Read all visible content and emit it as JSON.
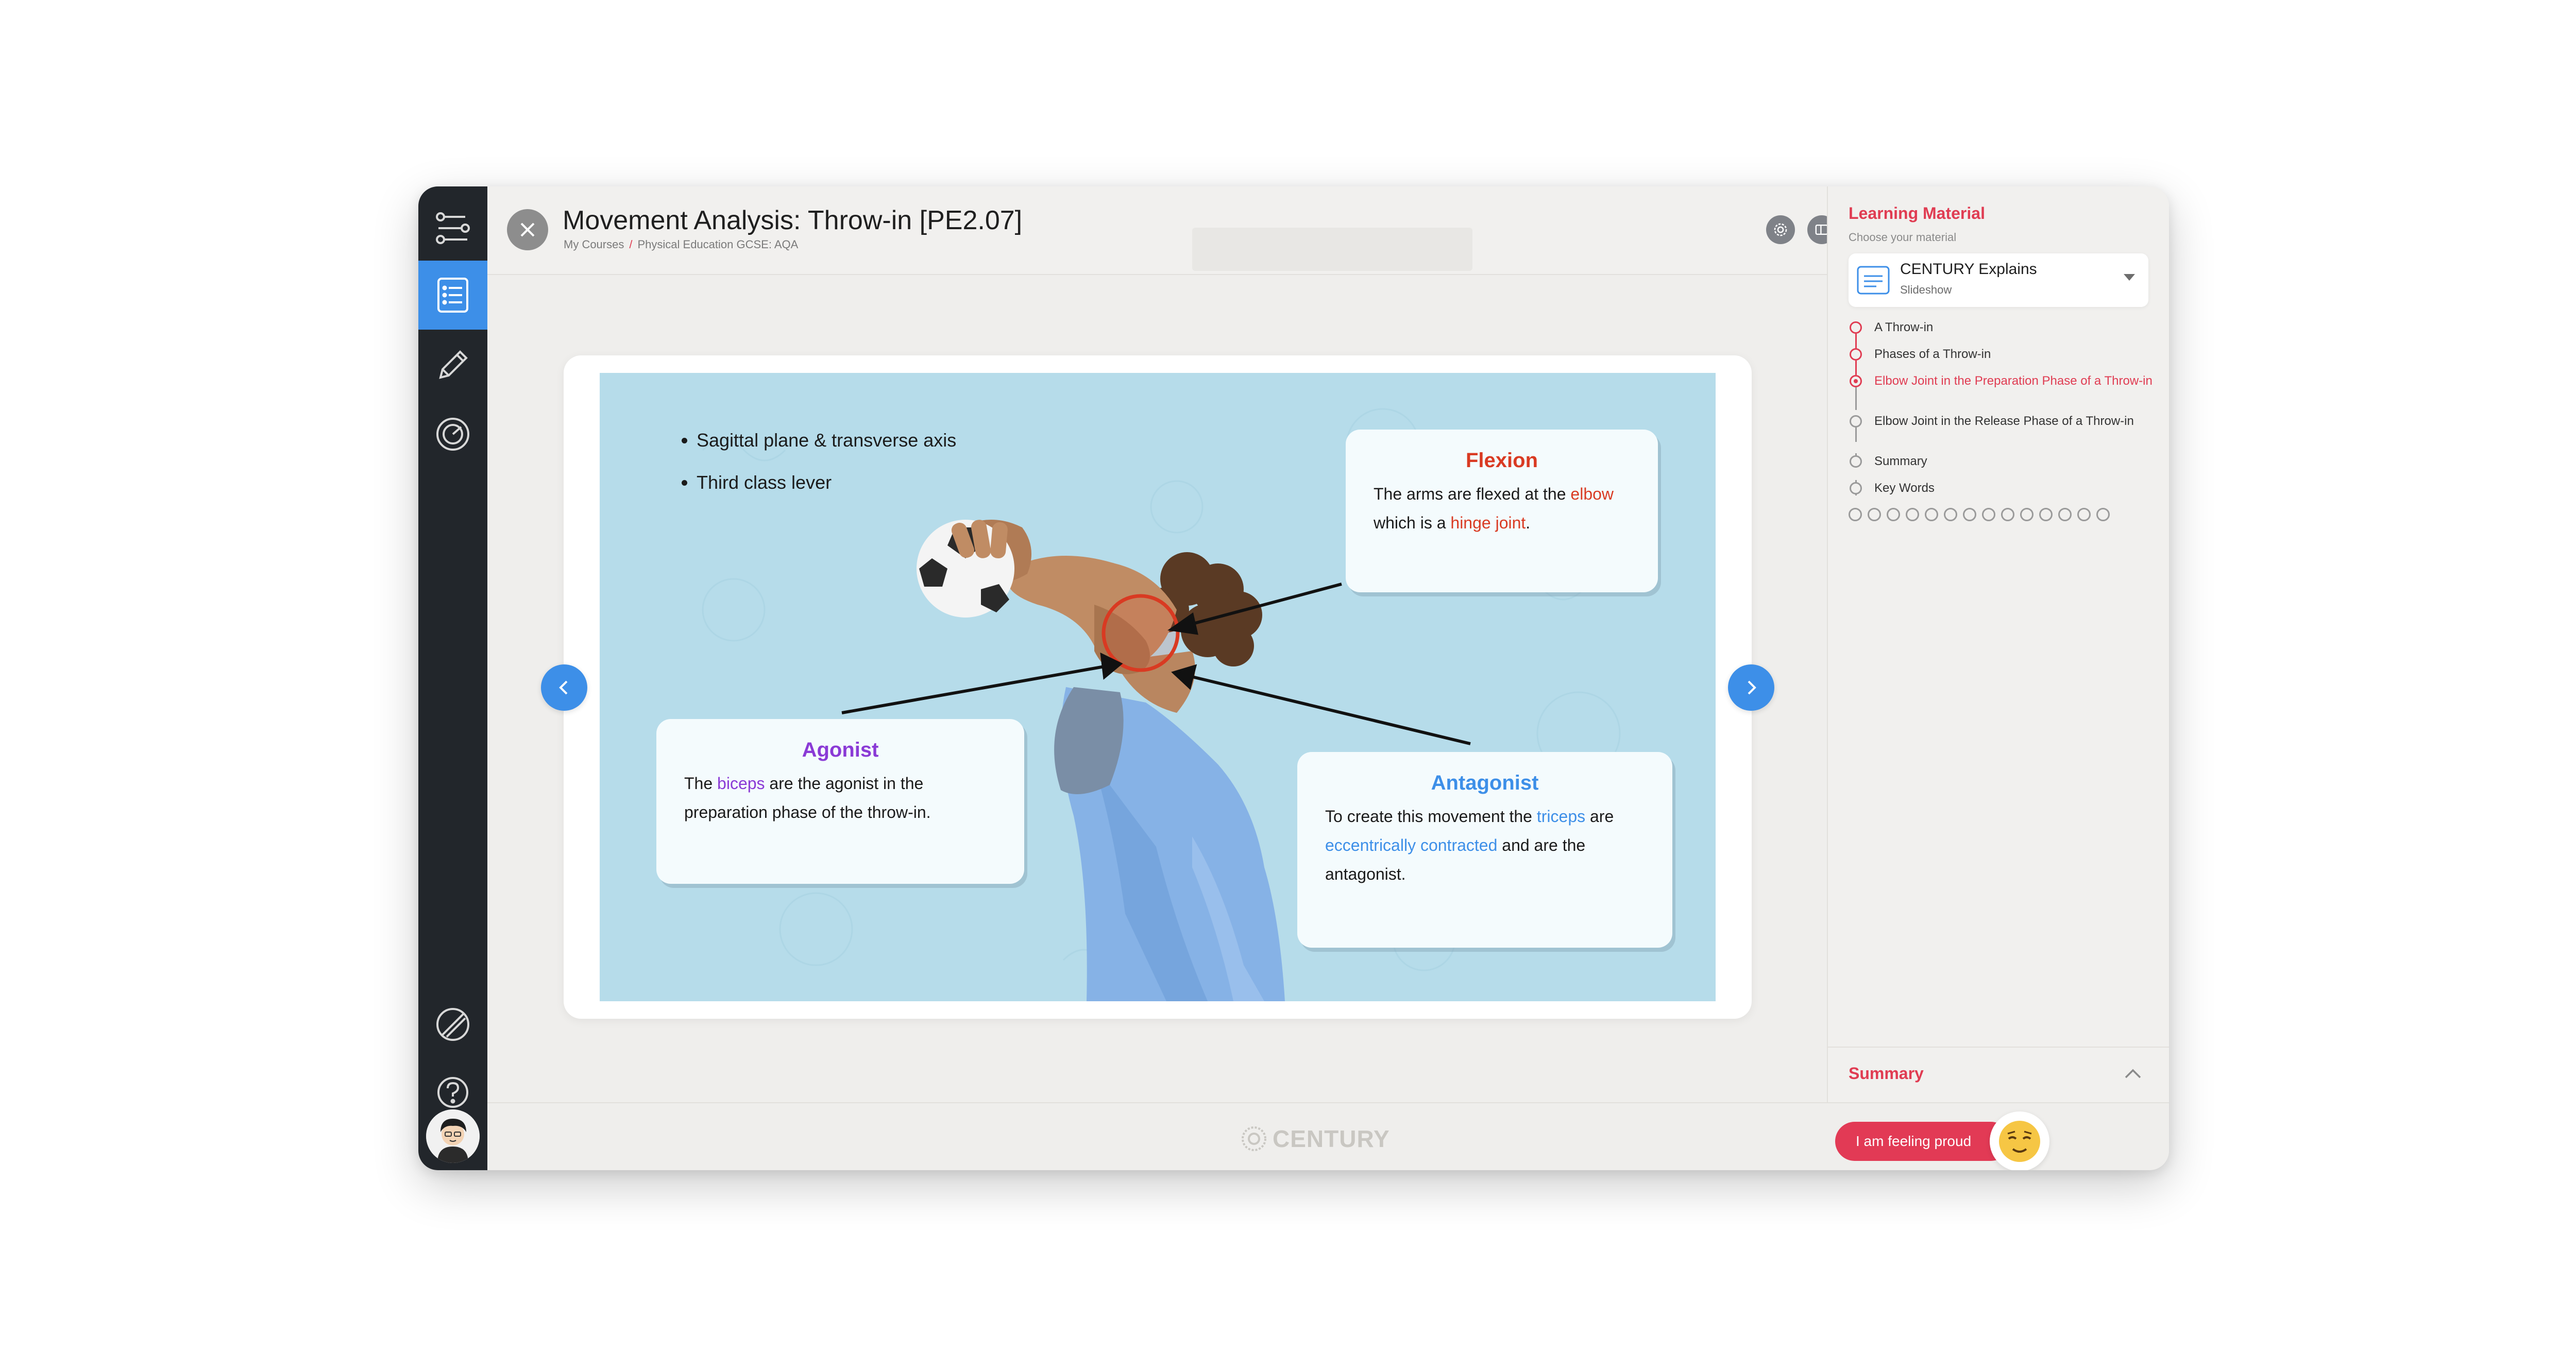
{
  "header": {
    "title": "Movement Analysis: Throw-in [PE2.07]",
    "breadcrumb": [
      "My Courses",
      "Physical Education GCSE: AQA"
    ],
    "breadcrumb_sep": "/"
  },
  "slide": {
    "bullets": [
      "Sagittal plane & transverse axis",
      "Third class lever"
    ],
    "flexion": {
      "title": "Flexion",
      "text_1": "The arms are flexed at the ",
      "highlight_1": "elbow",
      "text_2": " which is a ",
      "highlight_2": "hinge joint",
      "text_3": "."
    },
    "agonist": {
      "title": "Agonist",
      "text_1": "The ",
      "highlight_1": "biceps",
      "text_2": " are the agonist in the preparation phase of the throw-in."
    },
    "antagonist": {
      "title": "Antagonist",
      "text_1": "To create this movement the ",
      "highlight_1": "triceps",
      "text_2": " are ",
      "highlight_2": "eccentrically contracted",
      "text_3": " and are the antagonist."
    }
  },
  "panel": {
    "title": "Learning Material",
    "subtitle": "Choose your material",
    "material_name": "CENTURY Explains",
    "material_type": "Slideshow",
    "steps": [
      {
        "label": "A Throw-in",
        "state": "done"
      },
      {
        "label": "Phases of a Throw-in",
        "state": "done"
      },
      {
        "label": "Elbow Joint in the Preparation Phase of a Throw-in",
        "state": "current"
      },
      {
        "label": "Elbow Joint in the Release Phase of a Throw-in",
        "state": "todo"
      },
      {
        "label": "Summary",
        "state": "todo"
      },
      {
        "label": "Key Words",
        "state": "todo"
      }
    ],
    "summary_label": "Summary"
  },
  "footer": {
    "logo_text": "CENTURY",
    "feeling_button": "I am feeling proud"
  },
  "colors": {
    "accent_blue": "#3d8fe8",
    "accent_red": "#e03c52",
    "flexion_red": "#d93a22",
    "agonist_purple": "#8a3ad6",
    "antagonist_blue": "#3d8fe8",
    "rail_dark": "#22262b",
    "slide_bg": "#b6dcea"
  },
  "icons": {
    "rail": [
      "pathway-icon",
      "course-list-icon",
      "pencil-icon",
      "dashboard-gauge-icon",
      "no-entry-icon",
      "help-icon"
    ],
    "header": [
      "settings-icon",
      "layout-icon"
    ],
    "material": "slideshow-icon"
  }
}
